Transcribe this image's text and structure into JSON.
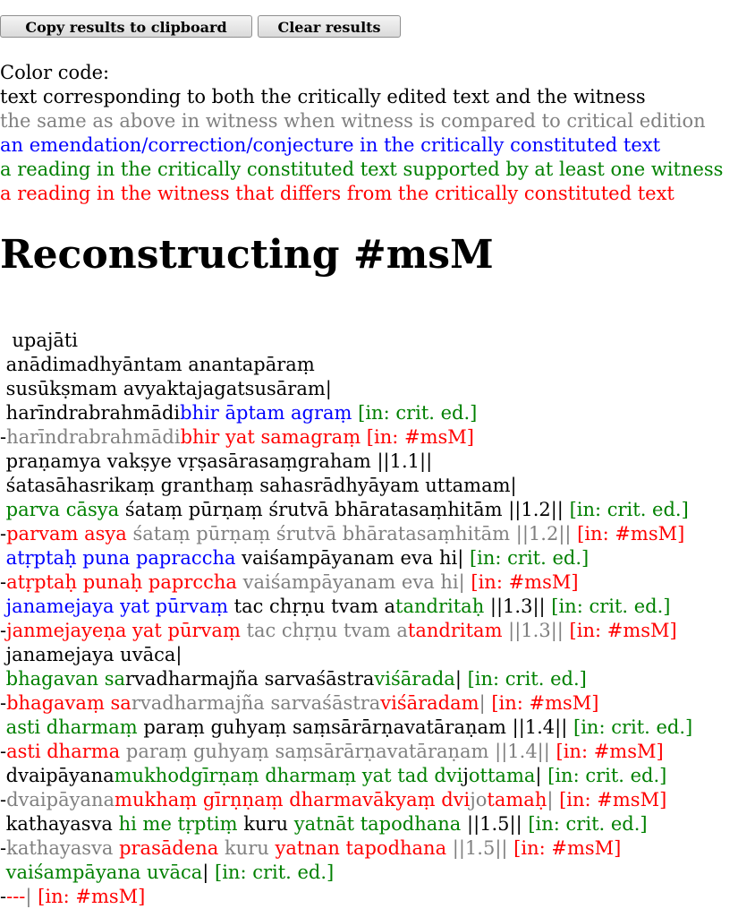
{
  "buttons": {
    "copy_label": "Copy results to clipboard",
    "clear_label": "Clear results"
  },
  "colors": {
    "black": "#000000",
    "gray": "#808080",
    "blue": "#0000ff",
    "green": "#008000",
    "red": "#ff0000"
  },
  "legend": {
    "title": "Color code:",
    "items": [
      {
        "color": "black",
        "text": "text corresponding to both the critically edited text and the witness"
      },
      {
        "color": "gray",
        "text": "the same as above in witness when witness is compared to critical edition"
      },
      {
        "color": "blue",
        "text": "an emendation/correction/conjecture in the critically constituted text"
      },
      {
        "color": "green",
        "text": "a reading in the critically constituted text supported by at least one witness"
      },
      {
        "color": "red",
        "text": "a reading in the witness that differs from the critically constituted text"
      }
    ]
  },
  "heading": "Reconstructing #msM",
  "lines": [
    [
      {
        "c": "k",
        "t": "  upajāti"
      }
    ],
    [
      {
        "c": "k",
        "t": " anādimadhyāntam anantapāraṃ"
      }
    ],
    [
      {
        "c": "k",
        "t": " susūkṣmam avyaktajagatsusāram|"
      }
    ],
    [
      {
        "c": "k",
        "t": " harīndrabrahmādi"
      },
      {
        "c": "b",
        "t": "bhir āptam agraṃ"
      },
      {
        "c": "gr",
        "t": " [in: crit. ed.]"
      }
    ],
    [
      {
        "c": "k",
        "t": "-"
      },
      {
        "c": "g",
        "t": "harīndrabrahmādi"
      },
      {
        "c": "r",
        "t": "bhir yat samagraṃ"
      },
      {
        "c": "r",
        "t": " [in: #msM]"
      }
    ],
    [
      {
        "c": "k",
        "t": " praṇamya vakṣye vṛṣasārasaṃgraham ||1.1||"
      }
    ],
    [
      {
        "c": "k",
        "t": " śatasāhasrikaṃ granthaṃ sahasrādhyāyam uttamam|"
      }
    ],
    [
      {
        "c": "gr",
        "t": " parva cāsya"
      },
      {
        "c": "k",
        "t": " śataṃ pūrṇaṃ śrutvā bhāratasaṃhitām ||1.2||"
      },
      {
        "c": "gr",
        "t": " [in: crit. ed.]"
      }
    ],
    [
      {
        "c": "k",
        "t": "-"
      },
      {
        "c": "r",
        "t": "parvam asya"
      },
      {
        "c": "g",
        "t": " śataṃ pūrṇaṃ śrutvā bhāratasaṃhitām ||1.2||"
      },
      {
        "c": "r",
        "t": " [in: #msM]"
      }
    ],
    [
      {
        "c": "b",
        "t": " atṛptaḥ puna papraccha"
      },
      {
        "c": "k",
        "t": " vaiśampāyanam eva hi|"
      },
      {
        "c": "gr",
        "t": " [in: crit. ed.]"
      }
    ],
    [
      {
        "c": "k",
        "t": "-"
      },
      {
        "c": "r",
        "t": "atṛptaḥ punaḥ paprccha"
      },
      {
        "c": "g",
        "t": " vaiśampāyanam eva hi|"
      },
      {
        "c": "r",
        "t": " [in: #msM]"
      }
    ],
    [
      {
        "c": "b",
        "t": " janamejaya yat pūrvaṃ"
      },
      {
        "c": "k",
        "t": " tac chṛṇu tvam a"
      },
      {
        "c": "gr",
        "t": "tandritaḥ"
      },
      {
        "c": "k",
        "t": " ||1.3||"
      },
      {
        "c": "gr",
        "t": " [in: crit. ed.]"
      }
    ],
    [
      {
        "c": "k",
        "t": "-"
      },
      {
        "c": "r",
        "t": "janmejayeṇa yat pūrvaṃ"
      },
      {
        "c": "g",
        "t": " tac chṛṇu tvam a"
      },
      {
        "c": "r",
        "t": "tandritam"
      },
      {
        "c": "g",
        "t": " ||1.3||"
      },
      {
        "c": "r",
        "t": " [in: #msM]"
      }
    ],
    [
      {
        "c": "k",
        "t": " janamejaya uvāca|"
      }
    ],
    [
      {
        "c": "gr",
        "t": " bhagavan sa"
      },
      {
        "c": "k",
        "t": "rvadharmajña sarvaśāstra"
      },
      {
        "c": "gr",
        "t": "viśārada"
      },
      {
        "c": "k",
        "t": "|"
      },
      {
        "c": "gr",
        "t": " [in: crit. ed.]"
      }
    ],
    [
      {
        "c": "k",
        "t": "-"
      },
      {
        "c": "r",
        "t": "bhagavaṃ sa"
      },
      {
        "c": "g",
        "t": "rvadharmajña sarvaśāstra"
      },
      {
        "c": "r",
        "t": "viśāradam"
      },
      {
        "c": "g",
        "t": "|"
      },
      {
        "c": "r",
        "t": " [in: #msM]"
      }
    ],
    [
      {
        "c": "gr",
        "t": " asti dharmaṃ"
      },
      {
        "c": "k",
        "t": " paraṃ guhyaṃ saṃsārārṇavatāraṇam ||1.4||"
      },
      {
        "c": "gr",
        "t": " [in: crit. ed.]"
      }
    ],
    [
      {
        "c": "k",
        "t": "-"
      },
      {
        "c": "r",
        "t": "asti dharma"
      },
      {
        "c": "g",
        "t": " paraṃ guhyaṃ saṃsārārṇavatāraṇam ||1.4||"
      },
      {
        "c": "r",
        "t": " [in: #msM]"
      }
    ],
    [
      {
        "c": "k",
        "t": " dvaipāyana"
      },
      {
        "c": "gr",
        "t": "mukhodgīrṇaṃ dharmaṃ yat tad dvi"
      },
      {
        "c": "k",
        "t": "j"
      },
      {
        "c": "gr",
        "t": "ottama"
      },
      {
        "c": "k",
        "t": "|"
      },
      {
        "c": "gr",
        "t": " [in: crit. ed.]"
      }
    ],
    [
      {
        "c": "k",
        "t": "-"
      },
      {
        "c": "g",
        "t": "dvaipāyana"
      },
      {
        "c": "r",
        "t": "mukhaṃ gīrṇṇaṃ dharmavākyaṃ dvi"
      },
      {
        "c": "g",
        "t": "jo"
      },
      {
        "c": "r",
        "t": "tamaḥ"
      },
      {
        "c": "g",
        "t": "|"
      },
      {
        "c": "r",
        "t": " [in: #msM]"
      }
    ],
    [
      {
        "c": "k",
        "t": " kathayasva"
      },
      {
        "c": "gr",
        "t": " hi me tṛptiṃ"
      },
      {
        "c": "k",
        "t": " kuru"
      },
      {
        "c": "gr",
        "t": " yatnāt tapodhana"
      },
      {
        "c": "k",
        "t": " ||1.5||"
      },
      {
        "c": "gr",
        "t": " [in: crit. ed.]"
      }
    ],
    [
      {
        "c": "k",
        "t": "-"
      },
      {
        "c": "g",
        "t": "kathayasva"
      },
      {
        "c": "r",
        "t": " prasādena"
      },
      {
        "c": "g",
        "t": " kuru"
      },
      {
        "c": "r",
        "t": " yatnan tapodhana"
      },
      {
        "c": "g",
        "t": " ||1.5||"
      },
      {
        "c": "r",
        "t": " [in: #msM]"
      }
    ],
    [
      {
        "c": "gr",
        "t": " vaiśampāyana uvāca"
      },
      {
        "c": "k",
        "t": "|"
      },
      {
        "c": "gr",
        "t": " [in: crit. ed.]"
      }
    ],
    [
      {
        "c": "k",
        "t": "-"
      },
      {
        "c": "r",
        "t": "---"
      },
      {
        "c": "g",
        "t": "|"
      },
      {
        "c": "r",
        "t": " [in: #msM]"
      }
    ]
  ]
}
